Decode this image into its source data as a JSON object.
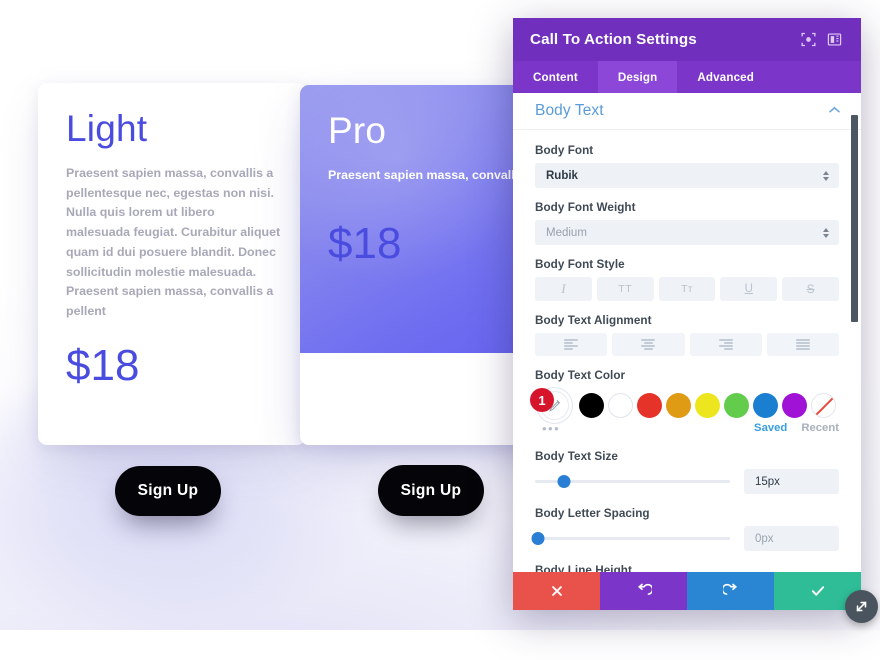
{
  "background": {
    "cards": [
      {
        "id": "light",
        "title": "Light",
        "body": "Praesent sapien massa, convallis a pellentesque nec, egestas non nisi. Nulla quis lorem ut libero malesuada feugiat. Curabitur aliquet quam id dui posuere blandit. Donec sollicitudin molestie malesuada. Praesent sapien massa, convallis a pellent",
        "price": "$18",
        "button": "Sign Up"
      },
      {
        "id": "pro",
        "title": "Pro",
        "body": "Praesent sapien massa, convallis a pellentesque nec, egestas non nisi. Nulla quis lorem ut libero malesuada feugiat. Curabitur aliquet quam id dui posuere blandit. Donec sollicitudin molestie malesuada. Praesent sapien massa, convallis a pellent",
        "price": "$18",
        "button": "Sign Up"
      }
    ],
    "accent_color": "#4a4ce0",
    "pro_gradient_from": "#9a9cf0",
    "pro_gradient_to": "#6360ef"
  },
  "modal": {
    "title": "Call To Action Settings",
    "header_color": "#7030bd",
    "header_icons": [
      {
        "name": "focus-target-icon"
      },
      {
        "name": "panel-layout-icon"
      }
    ],
    "tabs": [
      {
        "label": "Content",
        "active": false
      },
      {
        "label": "Design",
        "active": true
      },
      {
        "label": "Advanced",
        "active": false
      }
    ],
    "section": {
      "title": "Body Text",
      "collapsed": false,
      "chevron": "chevron-up-icon",
      "title_color": "#5a9bd8"
    },
    "fields": {
      "body_font": {
        "label": "Body Font",
        "value": "Rubik"
      },
      "body_font_weight": {
        "label": "Body Font Weight",
        "value": "Medium"
      },
      "body_font_style": {
        "label": "Body Font Style",
        "options": [
          {
            "name": "italic-button",
            "glyph": "I"
          },
          {
            "name": "uppercase-button",
            "glyph": "TT"
          },
          {
            "name": "capitalize-button",
            "glyph": "Tт"
          },
          {
            "name": "underline-button",
            "glyph": "U"
          },
          {
            "name": "strikethrough-button",
            "glyph": "S"
          }
        ]
      },
      "body_text_alignment": {
        "label": "Body Text Alignment",
        "options": [
          "left",
          "center",
          "right",
          "justify"
        ]
      },
      "body_text_color": {
        "label": "Body Text Color",
        "badge": "1",
        "badge_color": "#d6142c",
        "picker_icon": "eyedropper-icon",
        "swatches": [
          "#000000",
          "#ffffff",
          "#e63329",
          "#e09b15",
          "#ede61f",
          "#63cc4c",
          "#1b7fd1",
          "#9f12d6"
        ],
        "transparent_label": "none",
        "more_label": "•••",
        "saved_label": "Saved",
        "recent_label": "Recent"
      },
      "body_text_size": {
        "label": "Body Text Size",
        "value": "15px",
        "slider_percent": 15
      },
      "body_letter_spacing": {
        "label": "Body Letter Spacing",
        "value": "0px",
        "slider_percent": 0
      },
      "body_line_height": {
        "label": "Body Line Height"
      }
    },
    "footer": {
      "cancel": {
        "name": "cancel-button",
        "glyph": "✕",
        "color": "#e8524a"
      },
      "undo": {
        "name": "undo-button",
        "glyph": "↺",
        "color": "#7b35c9"
      },
      "redo": {
        "name": "redo-button",
        "glyph": "↻",
        "color": "#2a86d2"
      },
      "save": {
        "name": "save-button",
        "glyph": "✔",
        "color": "#2ebd96"
      }
    },
    "resize_handle": "resize-handle-icon"
  }
}
